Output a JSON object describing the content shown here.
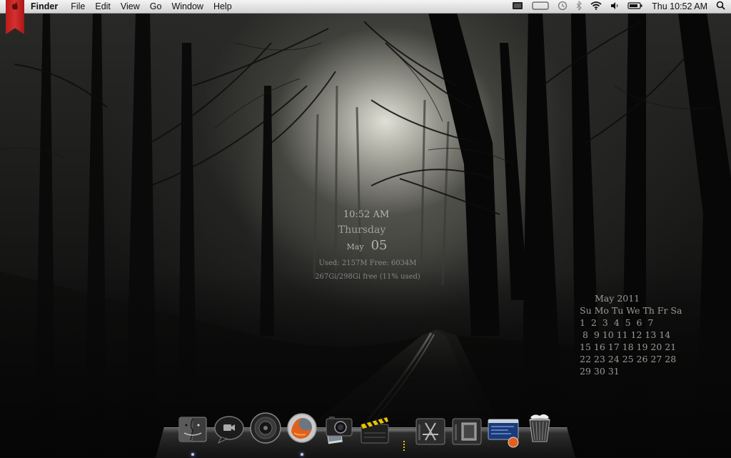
{
  "menubar": {
    "app_name": "Finder",
    "menus": [
      "File",
      "Edit",
      "View",
      "Go",
      "Window",
      "Help"
    ],
    "clock": "Thu 10:52 AM",
    "status_icons": [
      "display-icon",
      "battery-monitor-icon",
      "time-machine-icon",
      "bluetooth-icon",
      "wifi-icon",
      "volume-icon",
      "battery-icon",
      "spotlight-search-icon"
    ]
  },
  "widgets": {
    "time": "10:52 AM",
    "weekday": "Thursday",
    "month": "May",
    "day": "05",
    "memory": "Used: 2157M Free: 6034M",
    "disk": "267Gi/298Gi free (11% used)"
  },
  "calendar": {
    "title": "May 2011",
    "header": "Su Mo Tu We Th Fr Sa",
    "rows": [
      "1  2  3  4  5  6  7",
      " 8  9 10 11 12 13 14",
      "15 16 17 18 19 20 21",
      "22 23 24 25 26 27 28",
      "29 30 31"
    ]
  },
  "dock": {
    "items": [
      {
        "name": "finder-icon"
      },
      {
        "name": "facetime-icon"
      },
      {
        "name": "speaker-icon"
      },
      {
        "name": "firefox-icon"
      },
      {
        "name": "image-capture-icon"
      },
      {
        "name": "clapperboard-icon"
      },
      {
        "name": "applications-folder-icon"
      },
      {
        "name": "documents-folder-icon"
      },
      {
        "name": "downloads-icon"
      },
      {
        "name": "trash-icon"
      }
    ]
  }
}
